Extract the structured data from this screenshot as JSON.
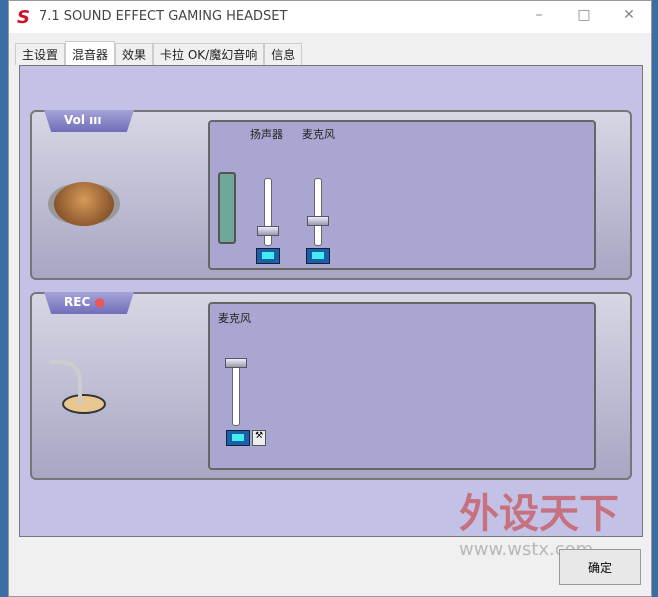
{
  "window": {
    "title": "7.1 SOUND EFFECT GAMING HEADSET",
    "logo": "S"
  },
  "tabs": [
    {
      "label": "主设置"
    },
    {
      "label": "混音器"
    },
    {
      "label": "效果"
    },
    {
      "label": "卡拉 OK/魔幻音响"
    },
    {
      "label": "信息"
    }
  ],
  "playback": {
    "label": "Vol",
    "channels": [
      {
        "label": "扬声器",
        "level": 0.1
      },
      {
        "label": "麦克风",
        "level": 0.3
      }
    ]
  },
  "record": {
    "label": "REC",
    "channels": [
      {
        "label": "麦克风",
        "level": 1.0
      }
    ]
  },
  "ok_label": "确定",
  "watermark": {
    "text": "外设天下",
    "url": "www.wstx.com"
  }
}
